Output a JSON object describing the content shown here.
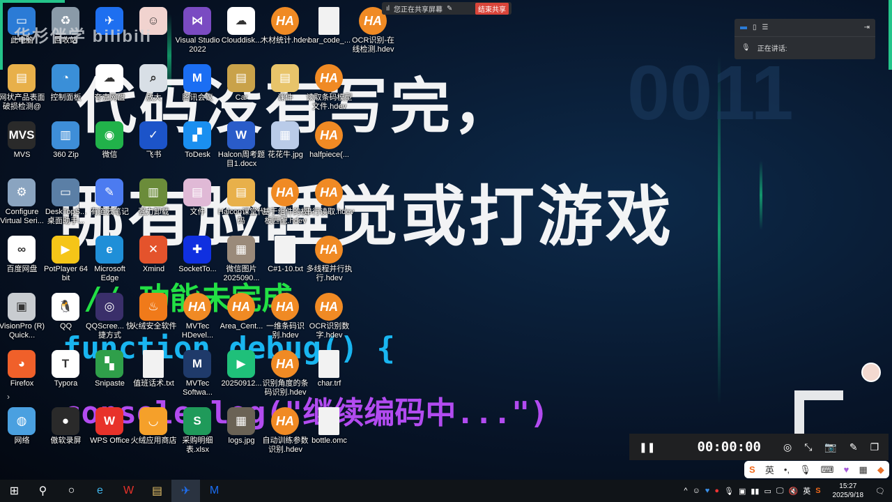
{
  "watermark": "华杉伴学 bilibili",
  "overlay": {
    "line1": "代码没有写完，",
    "line2": "哪有脸睡觉或打游戏",
    "code1": "// 功能未完成",
    "code2": "function debug() {",
    "code3": "console.log(\"继续编码中...\")",
    "number": "0011"
  },
  "share_bar": {
    "status": "您正在共享屏幕",
    "end_label": "结束共享"
  },
  "meeting_panel": {
    "speaking_label": "正在讲话:"
  },
  "recorder": {
    "timer": "00:00:00"
  },
  "ime": {
    "lang": "英"
  },
  "taskbar": {
    "tray_lang": "英",
    "time": "15:27",
    "date": "2025/9/18"
  },
  "desktop": [
    [
      {
        "l": "此电脑",
        "c": "#2b7bd6",
        "g": "▭"
      },
      {
        "l": "回收站",
        "c": "#8a9aa8",
        "g": "♻"
      },
      {
        "c": "#1e6ff0",
        "g": "✈"
      },
      {
        "c": "#f1d3cf",
        "g": "☺"
      },
      {
        "l": "Visual Studio 2022",
        "c": "#7a4bc2",
        "g": "⋈"
      },
      {
        "l": "Clouddisk...",
        "c": "#ffffff",
        "g": "☁"
      },
      {
        "l": "木材统计.hdev",
        "t": "ha"
      },
      {
        "l": "bar_code_...",
        "t": "file"
      },
      {
        "l": "OCR识别-在线检测.hdev",
        "t": "ha"
      }
    ],
    [
      {
        "l": "网状产品表面破损检测@",
        "c": "#e8b04a",
        "g": "▤"
      },
      {
        "l": "控制面板",
        "c": "#3a8fd8",
        "g": "◔"
      },
      {
        "l": "夸克网盘",
        "c": "#ffffff",
        "g": "☁"
      },
      {
        "l": "放大",
        "c": "#d8dfe6",
        "g": "⌕"
      },
      {
        "l": "腾讯会议",
        "c": "#1b6ef3",
        "g": "M"
      },
      {
        "l": "Car",
        "c": "#c9a24a",
        "g": "▤"
      },
      {
        "l": "课件",
        "c": "#e8c46a",
        "g": "▤"
      },
      {
        "l": "读取条码模型文件.hdev",
        "t": "ha"
      }
    ],
    [
      {
        "l": "MVS",
        "c": "#2a2a2a",
        "g": "MVS"
      },
      {
        "l": "360 Zip",
        "c": "#3e8ed8",
        "g": "▥"
      },
      {
        "l": "微信",
        "c": "#21b24a",
        "g": "◉"
      },
      {
        "l": "飞书",
        "c": "#1c54c9",
        "g": "✓"
      },
      {
        "l": "ToDesk",
        "c": "#1a8ff0",
        "g": "▞"
      },
      {
        "l": "Halcon周考题目1.docx",
        "c": "#2a5cc9",
        "g": "W"
      },
      {
        "l": "花花牛.jpg",
        "c": "#b9cbe8",
        "g": "▦"
      },
      {
        "l": "halfpiece(...",
        "t": "ha"
      }
    ],
    [
      {
        "l": "Configure Virtual Seri...",
        "c": "#8aa4c0",
        "g": "⚙"
      },
      {
        "l": "DeskTopS... 桌面助手...",
        "c": "#5b7fa6",
        "g": "▭"
      },
      {
        "l": "有道云笔记",
        "c": "#4c7bf0",
        "g": "✎"
      },
      {
        "l": "强力卸载",
        "c": "#6b8c3a",
        "g": "▥"
      },
      {
        "l": "文件",
        "c": "#e0b9d6",
        "g": "▤"
      },
      {
        "l": "Halcon课堂代码",
        "c": "#e8b04a",
        "g": "▤"
      },
      {
        "l": "基于组件的模板匹配.hdev",
        "t": "ha"
      },
      {
        "l": "串行读取.hdev",
        "t": "ha"
      }
    ],
    [
      {
        "l": "百度网盘",
        "c": "#ffffff",
        "g": "∞"
      },
      {
        "l": "PotPlayer 64 bit",
        "c": "#f5c518",
        "g": "▶"
      },
      {
        "l": "Microsoft Edge",
        "c": "#1f8fd8",
        "g": "e"
      },
      {
        "l": "Xmind",
        "c": "#e4532c",
        "g": "✕"
      },
      {
        "l": "SocketTo...",
        "c": "#1030e0",
        "g": "✚"
      },
      {
        "l": "微信图片2025090...",
        "c": "#9a8a7a",
        "g": "▦"
      },
      {
        "l": "C#1-10.txt",
        "t": "file"
      },
      {
        "l": "多线程并行执行.hdev",
        "t": "ha"
      }
    ],
    [
      {
        "l": "VisionPro (R) Quick...",
        "c": "#c8ccd0",
        "g": "▣"
      },
      {
        "l": "QQ",
        "c": "#ffffff",
        "g": "🐧"
      },
      {
        "l": "QQScree... 快捷方式",
        "c": "#3a2f6a",
        "g": "◎"
      },
      {
        "l": "火绒安全软件",
        "c": "#f07a1a",
        "g": "♨"
      },
      {
        "l": "MVTec HDevel...",
        "t": "ha"
      },
      {
        "l": "Area_Cent...",
        "t": "ha"
      },
      {
        "l": "一维条码识别.hdev",
        "t": "ha"
      },
      {
        "l": "OCR识别数字.hdev",
        "t": "ha"
      }
    ],
    [
      {
        "l": "Firefox",
        "c": "#f0602a",
        "g": "◕"
      },
      {
        "l": "Typora",
        "c": "#ffffff",
        "g": "T"
      },
      {
        "l": "Snipaste",
        "c": "#2f9f4a",
        "g": "▚"
      },
      {
        "l": "值班话术.txt",
        "t": "file"
      },
      {
        "l": "MVTec Softwa...",
        "c": "#1f3a6a",
        "g": "M"
      },
      {
        "l": "20250912...",
        "c": "#1fc07a",
        "g": "▶"
      },
      {
        "l": "识别角度的条码识别.hdev",
        "t": "ha"
      },
      {
        "l": "char.trf",
        "t": "file"
      }
    ],
    [
      {
        "l": "网络",
        "c": "#4aa0e0",
        "g": "◍"
      },
      {
        "l": "傲软录屏",
        "c": "#2a2a2a",
        "g": "●"
      },
      {
        "l": "WPS Office",
        "c": "#e8322a",
        "g": "W"
      },
      {
        "l": "火绒应用商店",
        "c": "#f5a02a",
        "g": "◡"
      },
      {
        "l": "采购明细表.xlsx",
        "c": "#1f9a5a",
        "g": "S"
      },
      {
        "l": "logs.jpg",
        "c": "#6a6255",
        "g": "▦"
      },
      {
        "l": "自动训练参数识别.hdev",
        "t": "ha"
      },
      {
        "l": "bottle.omc",
        "t": "file"
      }
    ]
  ]
}
